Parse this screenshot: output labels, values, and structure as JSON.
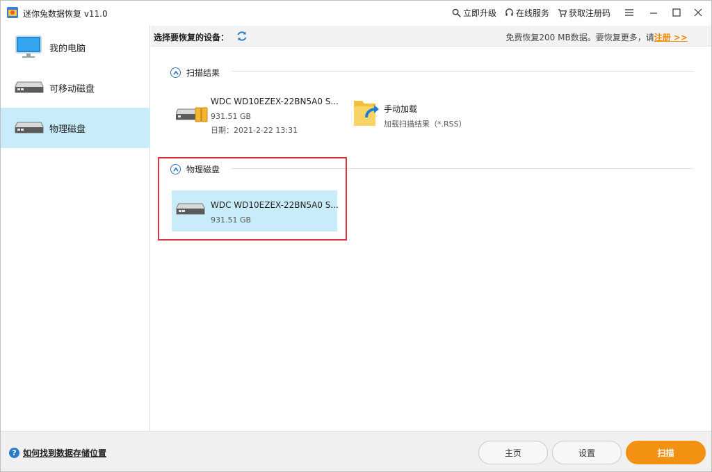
{
  "window": {
    "title": "迷你兔数据恢复 v11.0",
    "links": {
      "upgrade": "立即升级",
      "support": "在线服务",
      "get_code": "获取注册码"
    }
  },
  "sidebar": {
    "items": [
      {
        "label": "我的电脑",
        "icon": "monitor-icon"
      },
      {
        "label": "可移动磁盘",
        "icon": "removable-disk-icon"
      },
      {
        "label": "物理磁盘",
        "icon": "physical-disk-icon",
        "active": true
      }
    ]
  },
  "header": {
    "title": "选择要恢复的设备：",
    "notice": "免费恢复200 MB数据。要恢复更多，请",
    "register": "注册 >>"
  },
  "sections": {
    "scan_results": {
      "title": "扫描结果",
      "devices": [
        {
          "name": "WDC WD10EZEX-22BN5A0 S...",
          "size": "931.51 GB",
          "date": "日期：2021-2-22 13:31"
        }
      ],
      "manual_load": {
        "title": "手动加载",
        "subtitle": "加载扫描结果（*.RSS）"
      }
    },
    "physical_disks": {
      "title": "物理磁盘",
      "devices": [
        {
          "name": "WDC WD10EZEX-22BN5A0 S...",
          "size": "931.51 GB",
          "selected": true
        }
      ]
    }
  },
  "footer": {
    "help": "如何找到数据存储位置",
    "buttons": {
      "home": "主页",
      "settings": "设置",
      "scan": "扫描"
    }
  },
  "colors": {
    "accent": "#f39212",
    "selected": "#c8ecfa",
    "highlight_border": "#e0323a",
    "link_blue": "#2a6fb5"
  }
}
